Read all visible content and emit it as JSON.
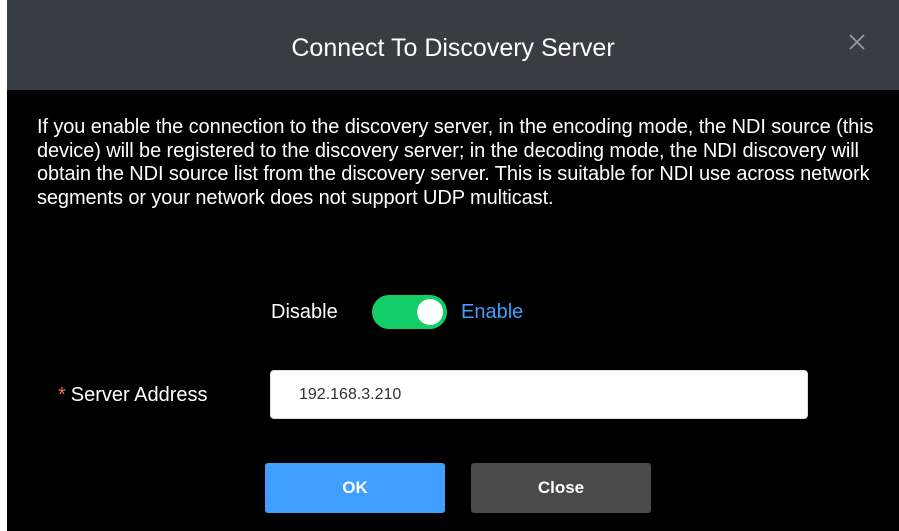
{
  "dialog": {
    "title": "Connect To Discovery Server",
    "close_icon": "close-icon",
    "description": "If you enable the connection to the discovery server, in the encoding mode, the NDI source (this device) will be registered to the discovery server; in the decoding mode, the NDI discovery will obtain the NDI source list from the discovery server. This is suitable for NDI use across network segments or your network does not support UDP multicast.",
    "toggle": {
      "off_label": "Disable",
      "on_label": "Enable",
      "state": "on"
    },
    "server_address": {
      "required_mark": "*",
      "label": "Server Address",
      "value": "192.168.3.210"
    },
    "buttons": {
      "ok_label": "OK",
      "close_label": "Close"
    }
  },
  "colors": {
    "header_bg": "#383c43",
    "dialog_bg": "#000000",
    "accent": "#409eff",
    "switch_on": "#13ce66",
    "required": "#f56c6c",
    "close_button_bg": "#4a4a4a"
  }
}
